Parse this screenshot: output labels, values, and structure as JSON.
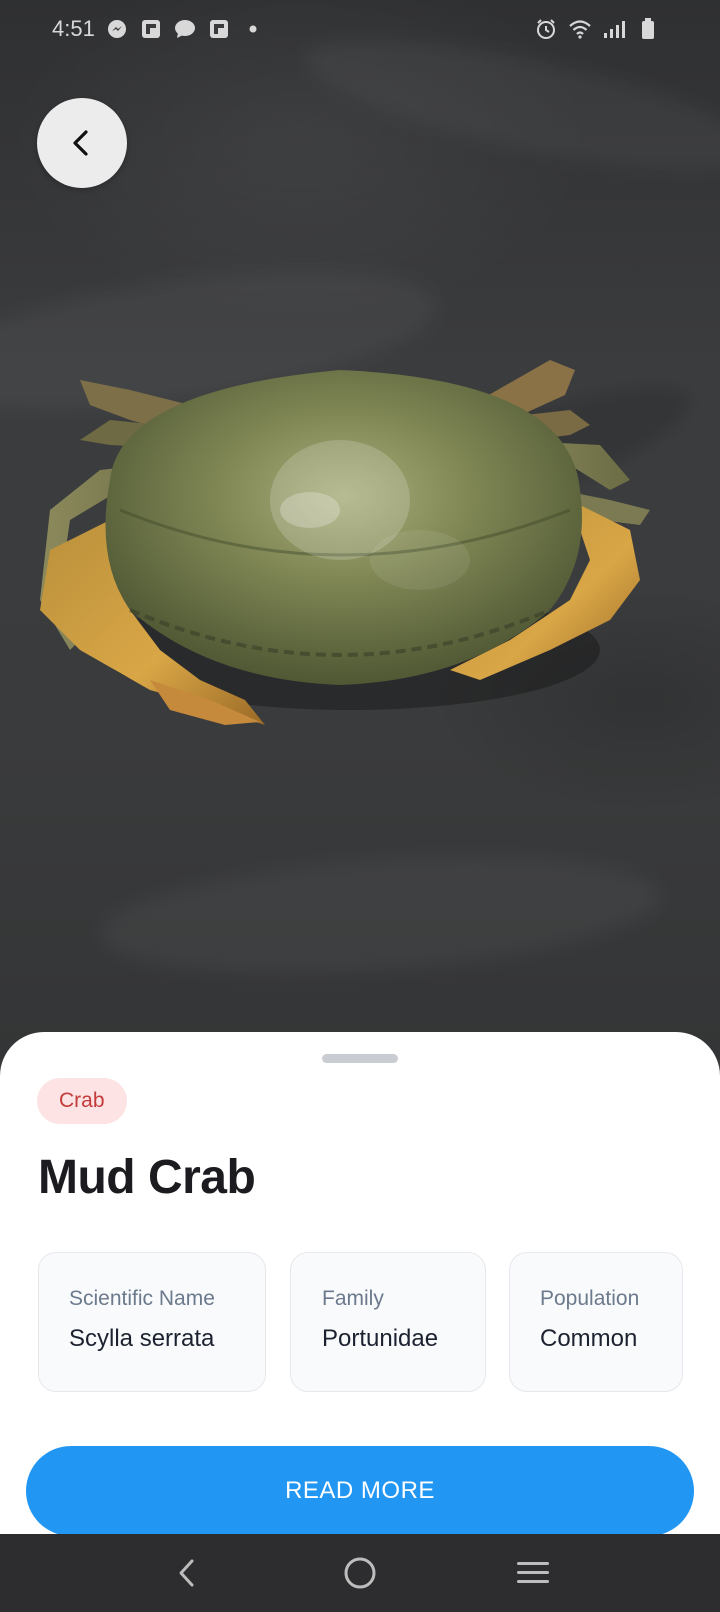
{
  "status_bar": {
    "time": "4:51",
    "left_icons": [
      "messenger-icon",
      "flipboard-icon",
      "chat-bubble-icon",
      "flipboard-icon",
      "dot-icon"
    ],
    "right_icons": [
      "alarm-icon",
      "wifi-icon",
      "signal-icon",
      "battery-icon"
    ]
  },
  "photo": {
    "subject": "mud-crab-photo"
  },
  "sheet": {
    "category_tag": "Crab",
    "title": "Mud Crab",
    "info": [
      {
        "label": "Scientific Name",
        "value": "Scylla serrata"
      },
      {
        "label": "Family",
        "value": "Portunidae"
      },
      {
        "label": "Population",
        "value": "Common"
      }
    ],
    "read_more_label": "READ MORE"
  },
  "colors": {
    "accent": "#2196f3",
    "tag_bg": "#fde3e3",
    "tag_text": "#c33b3b"
  },
  "nav_bar": {
    "buttons": [
      "back-icon",
      "home-icon",
      "recents-icon"
    ]
  }
}
